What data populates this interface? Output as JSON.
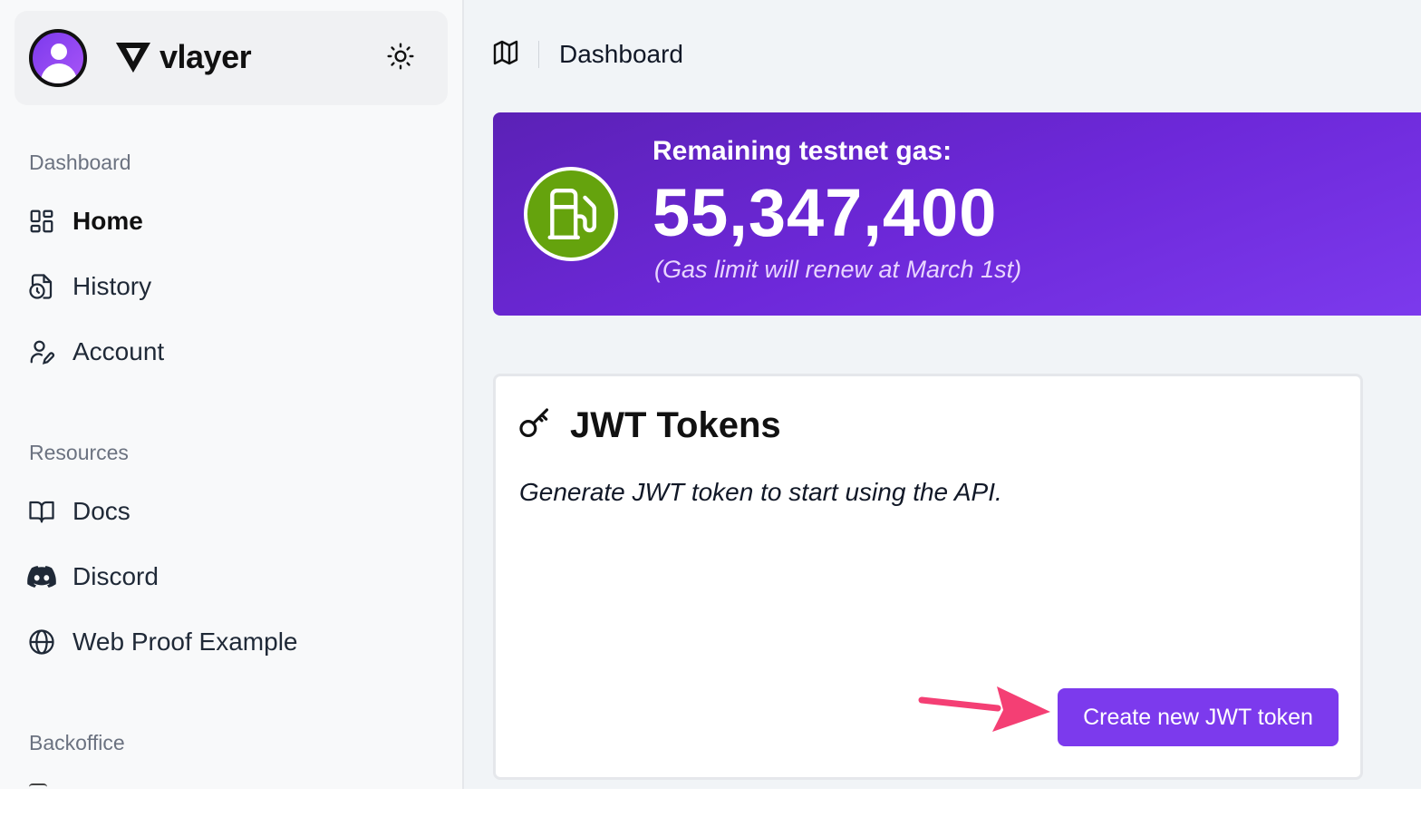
{
  "sidebar": {
    "brand": {
      "name": "vlayer"
    },
    "sections": [
      {
        "label": "Dashboard",
        "items": [
          {
            "label": "Home",
            "icon": "layout-grid-icon",
            "active": true
          },
          {
            "label": "History",
            "icon": "file-clock-icon"
          },
          {
            "label": "Account",
            "icon": "user-pen-icon"
          }
        ]
      },
      {
        "label": "Resources",
        "items": [
          {
            "label": "Docs",
            "icon": "book-open-icon"
          },
          {
            "label": "Discord",
            "icon": "discord-icon"
          },
          {
            "label": "Web Proof Example",
            "icon": "globe-icon"
          }
        ]
      },
      {
        "label": "Backoffice",
        "items": []
      }
    ]
  },
  "header": {
    "breadcrumb": "Dashboard",
    "icon": "map-icon"
  },
  "gas": {
    "label": "Remaining testnet gas:",
    "value": "55,347,400",
    "note": "(Gas limit will renew at March 1st)",
    "icon": "fuel-pump-icon"
  },
  "jwt": {
    "title": "JWT Tokens",
    "description": "Generate JWT token to start using the API.",
    "button_label": "Create new JWT token",
    "icon": "key-icon"
  },
  "colors": {
    "accent": "#7c3aed",
    "gas_card": "#6d28d9",
    "gas_icon_bg": "#65a30d",
    "annotation_arrow": "#f43f74"
  }
}
